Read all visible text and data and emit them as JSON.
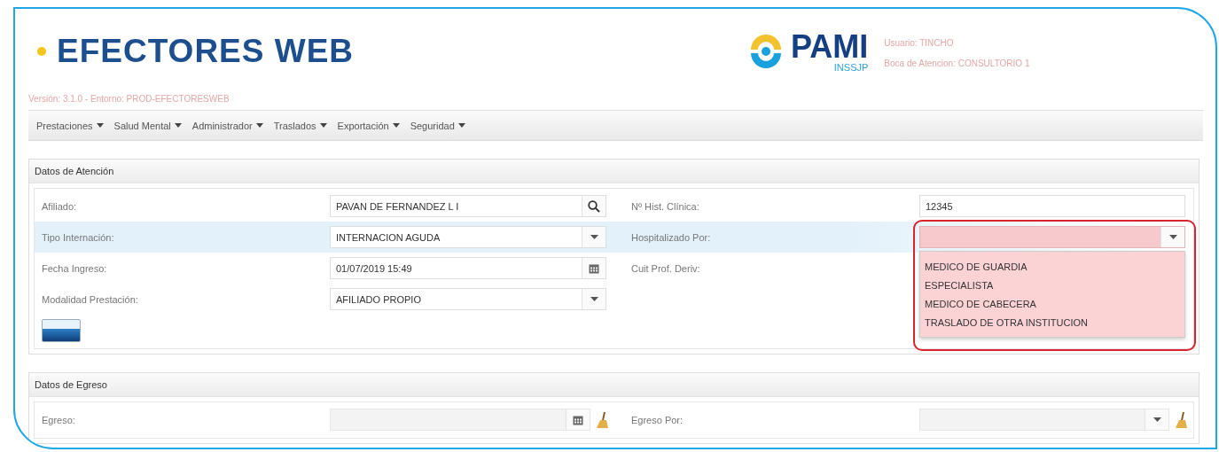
{
  "header": {
    "title": "EFECTORES WEB",
    "brand": "PAMI",
    "brand_subtitle": "INSSJP",
    "user": "Usuario: TINCHO",
    "service_point": "Boca de Atencion: CONSULTORIO 1",
    "version": "Versión: 3.1.0 - Entorno: PROD-EFECTORESWEB"
  },
  "menu": [
    {
      "label": "Prestaciones"
    },
    {
      "label": "Salud Mental"
    },
    {
      "label": "Administrador"
    },
    {
      "label": "Traslados"
    },
    {
      "label": "Exportación"
    },
    {
      "label": "Seguridad"
    }
  ],
  "sections": [
    {
      "title": "Datos de Atención",
      "rows": [
        {
          "hovered": false,
          "cells": [
            {
              "label": "Afiliado:",
              "kind": "search",
              "value": "PAVAN DE FERNANDEZ L I",
              "disabled": false
            },
            {
              "label": "Nº Hist. Clínica:",
              "kind": "text",
              "value": "12345",
              "disabled": false
            }
          ]
        },
        {
          "hovered": true,
          "cells": [
            {
              "label": "Tipo Internación:",
              "kind": "select",
              "value": "INTERNACION AGUDA",
              "disabled": false
            },
            {
              "label": "Hospitalizado Por:",
              "kind": "select",
              "disabled": false,
              "open": true
            }
          ]
        },
        {
          "hovered": false,
          "cells": [
            {
              "label": "Fecha Ingreso:",
              "kind": "date",
              "value": "01/07/2019 15:49",
              "disabled": false
            },
            {
              "label": "Cuit Prof. Deriv:"
            }
          ]
        },
        {
          "hovered": false,
          "cells": [
            {
              "label": "Modalidad Prestación:",
              "kind": "select",
              "value": "AFILIADO PROPIO",
              "disabled": false
            },
            {}
          ]
        },
        {
          "hovered": false,
          "cells": [
            {
              "kind": "card_button"
            }
          ]
        }
      ],
      "open_dropdown": {
        "marked": true,
        "options": [
          {
            "label": "MEDICO DE GUARDIA",
            "selected": false
          },
          {
            "label": "ESPECIALISTA",
            "selected": false
          },
          {
            "label": "MEDICO DE CABECERA",
            "selected": false
          },
          {
            "label": "TRASLADO DE OTRA INSTITUCION",
            "selected": false
          }
        ]
      }
    },
    {
      "title": "Datos de Egreso",
      "rows": [
        {
          "hovered": false,
          "cells": [
            {
              "label": "Egreso:",
              "kind": "date",
              "disabled": true,
              "clearable": true
            },
            {
              "label": "Egreso Por:",
              "kind": "select",
              "disabled": true,
              "clearable": true
            }
          ]
        }
      ]
    }
  ]
}
